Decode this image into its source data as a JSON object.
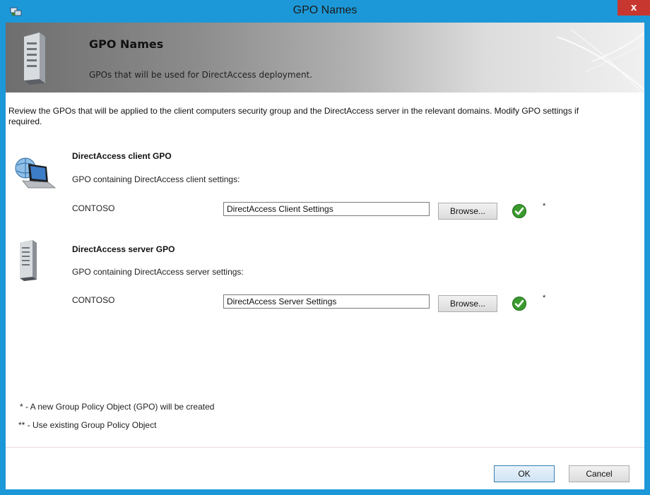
{
  "window": {
    "title": "GPO Names",
    "close_label": "x"
  },
  "banner": {
    "title": "GPO Names",
    "subtitle": "GPOs that will be used for DirectAccess deployment."
  },
  "description": "Review the GPOs that will be applied to the client computers security group and the DirectAccess server in the relevant domains. Modify GPO settings if required.",
  "client_section": {
    "title": "DirectAccess client GPO",
    "subtitle": "GPO containing DirectAccess client settings:",
    "domain": "CONTOSO",
    "gpo_value": "DirectAccess Client Settings",
    "browse_label": "Browse...",
    "marker": "*",
    "icon": "laptop-network-icon"
  },
  "server_section": {
    "title": "DirectAccess server GPO",
    "subtitle": "GPO containing DirectAccess server settings:",
    "domain": "CONTOSO",
    "gpo_value": "DirectAccess Server Settings",
    "browse_label": "Browse...",
    "marker": "*",
    "icon": "server-tower-icon"
  },
  "footnotes": {
    "new_gpo": "* - A new Group Policy Object (GPO) will be created",
    "existing_gpo": "** - Use existing Group Policy Object"
  },
  "buttons": {
    "ok": "OK",
    "cancel": "Cancel"
  },
  "colors": {
    "title_bar": "#1c98d8",
    "close_button": "#c7372f",
    "valid_check": "#3a9a2e"
  }
}
